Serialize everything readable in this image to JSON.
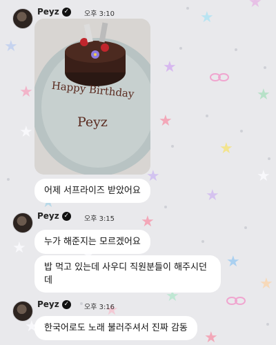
{
  "messages": [
    {
      "sender": "Peyz",
      "time": "오후 3:10",
      "type": "photo",
      "photo_text": [
        "Happy Birthday",
        "Peyz"
      ]
    },
    {
      "type": "text",
      "text": "어제 서프라이즈 받았어요"
    },
    {
      "sender": "Peyz",
      "time": "오후 3:15",
      "type": "text",
      "text": "누가 해준지는 모르겠어요"
    },
    {
      "type": "text",
      "text": "밥 먹고 있는데 사우디 직원분들이 해주시던 데"
    },
    {
      "sender": "Peyz",
      "time": "오후 3:16",
      "type": "text",
      "text": "한국어로도 노래 불러주셔서 진짜 감동"
    }
  ],
  "colors": {
    "background": "#e9e9ec",
    "bubble": "#ffffff"
  },
  "icons": [
    "verified-badge-icon"
  ]
}
